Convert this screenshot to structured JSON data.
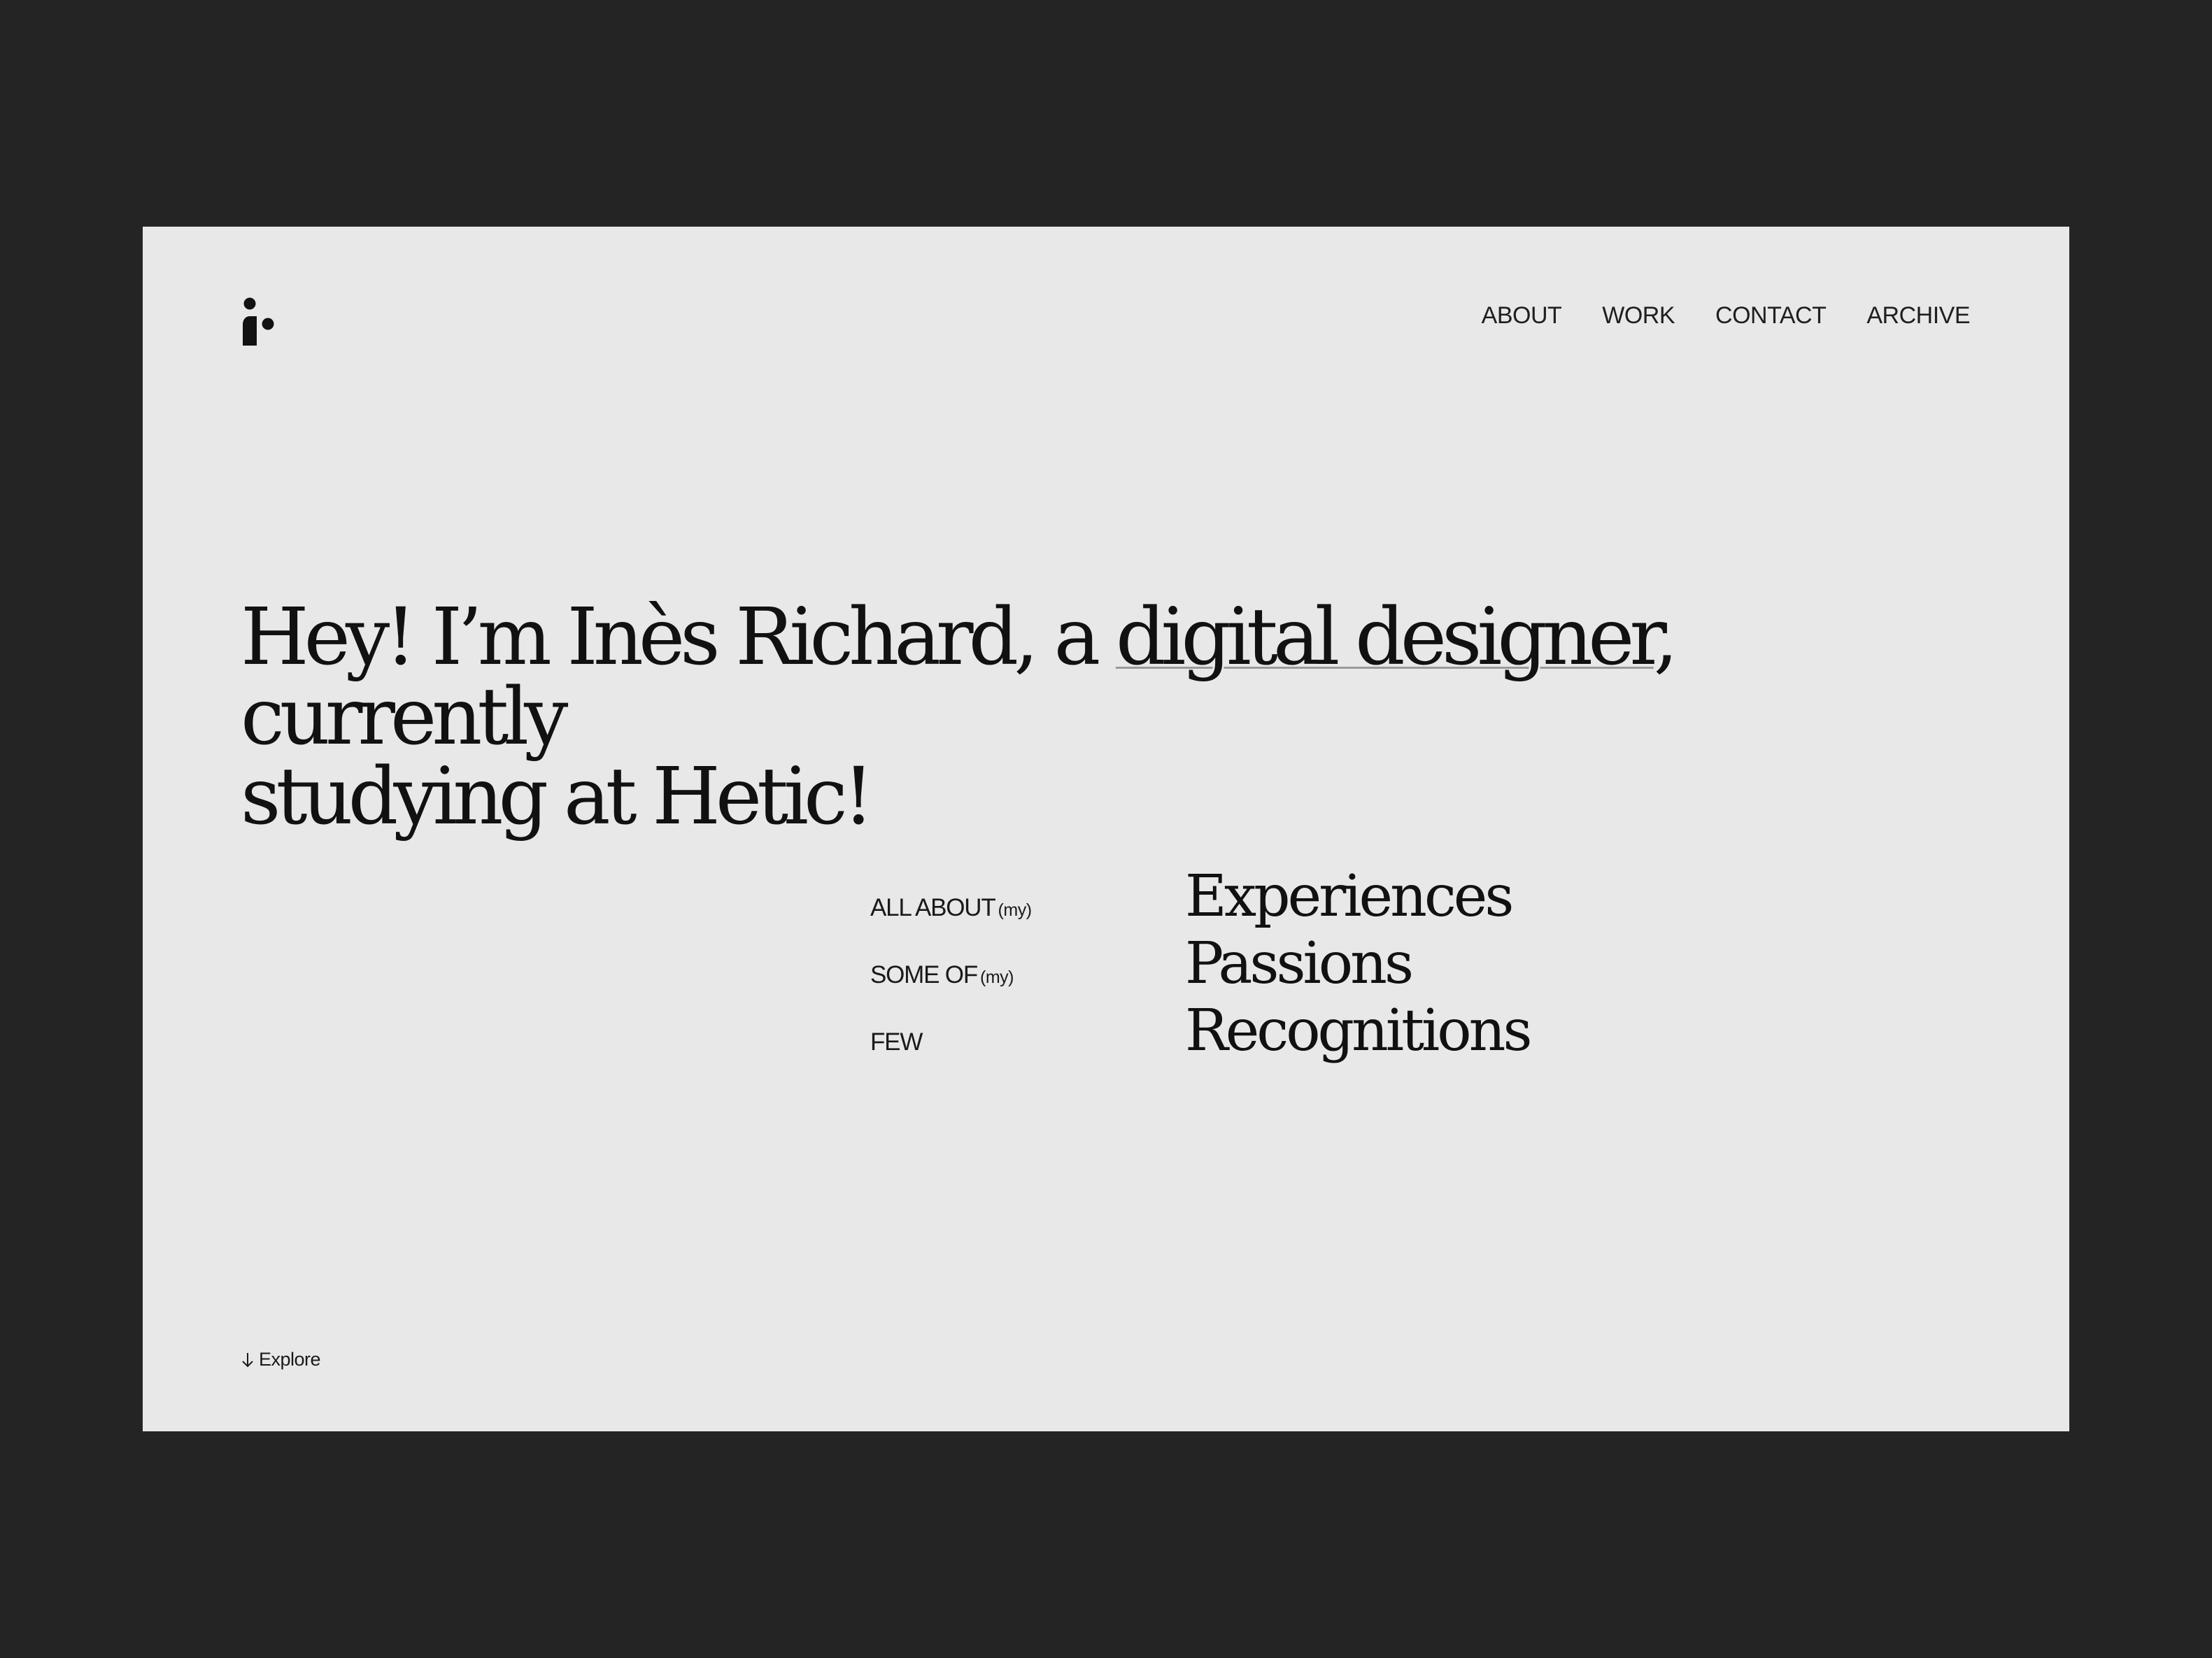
{
  "colors": {
    "backdrop": "#242424",
    "page": "#e8e8e8",
    "text": "#111111",
    "underline": "#9a9a9a"
  },
  "logo": {
    "icon": "i-dot-logo-icon"
  },
  "nav": {
    "items": [
      {
        "label": "ABOUT"
      },
      {
        "label": "WORK"
      },
      {
        "label": "CONTACT"
      },
      {
        "label": "ARCHIVE"
      }
    ]
  },
  "hero": {
    "line1_prefix": "Hey! I’m Inès Richard, a ",
    "link": "digital designer",
    "line1_suffix": ", currently",
    "line2": "studying at Hetic!"
  },
  "list": {
    "rows": [
      {
        "label": "ALL ABOUT",
        "qualifier": "(my)",
        "value": "Experiences"
      },
      {
        "label": "SOME OF",
        "qualifier": "(my)",
        "value": "Passions"
      },
      {
        "label": "FEW",
        "qualifier": "",
        "value": "Recognitions"
      }
    ]
  },
  "explore": {
    "icon": "arrow-down-icon",
    "label": "Explore"
  }
}
